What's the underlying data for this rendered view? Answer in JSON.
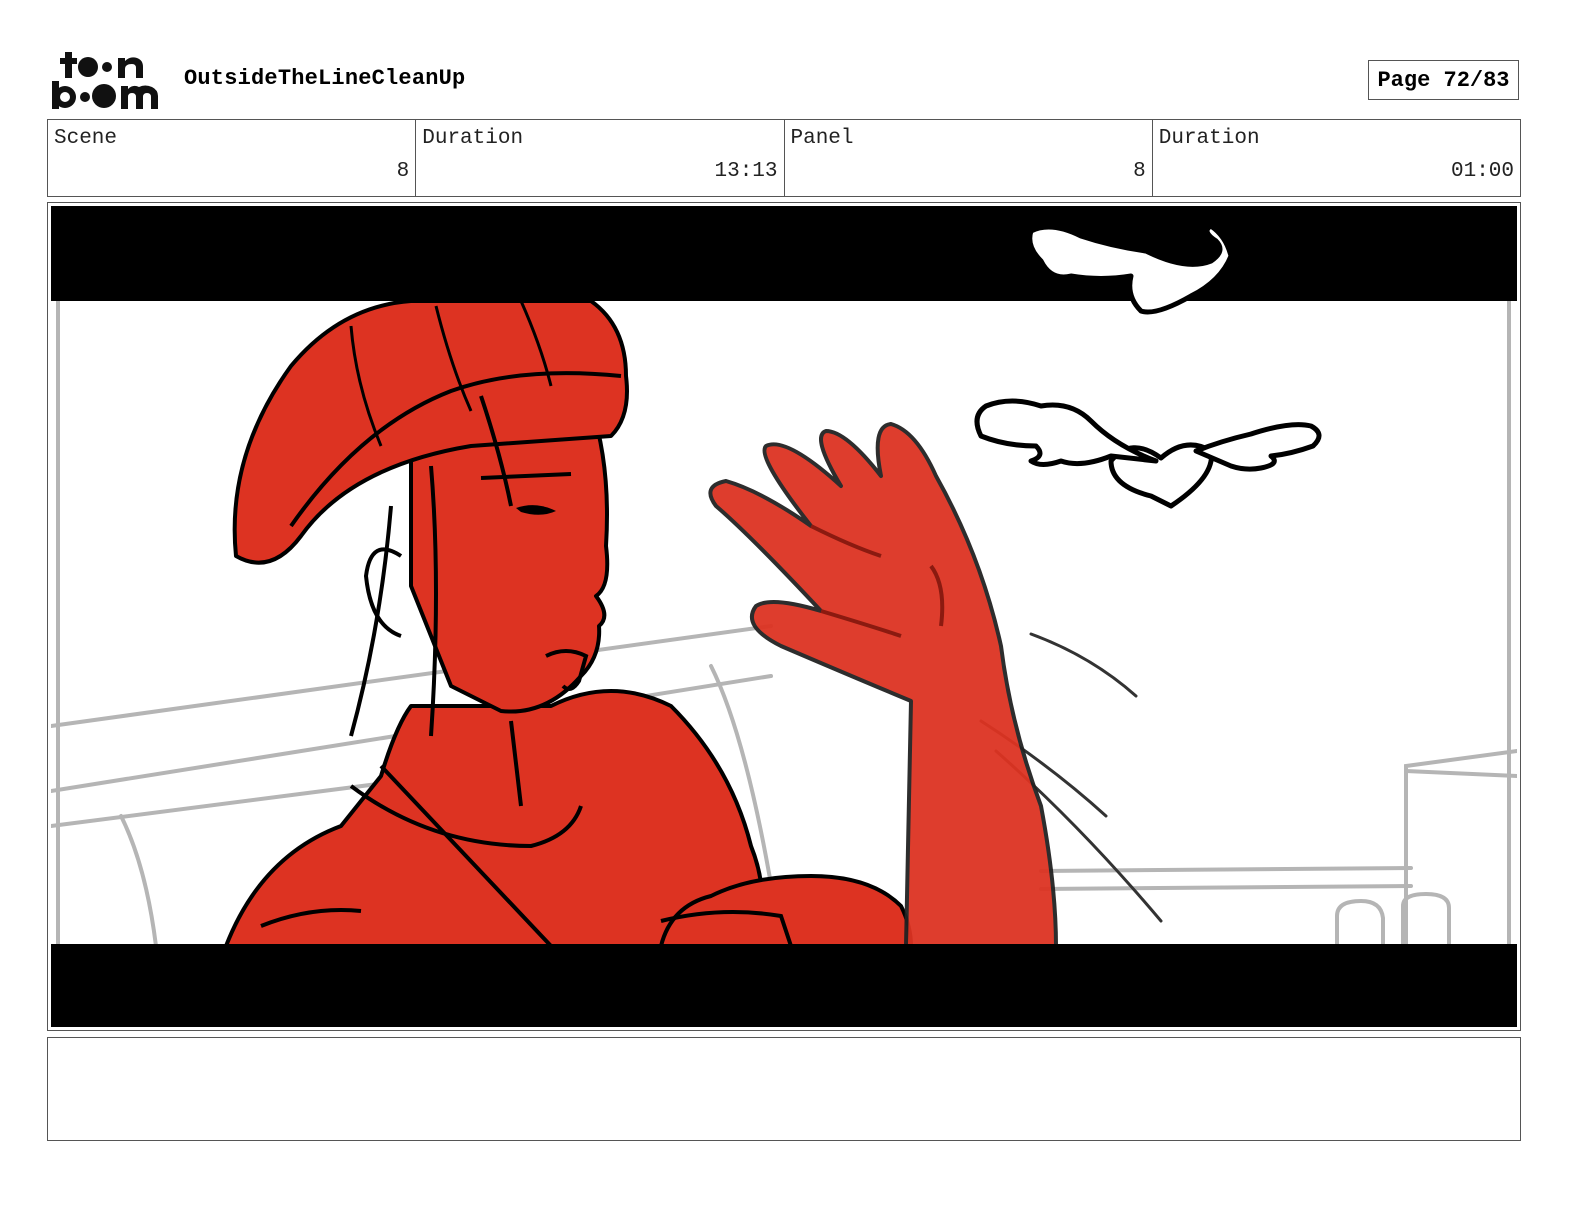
{
  "header": {
    "logo_text": "toon boom",
    "project_title": "OutsideTheLineCleanUp",
    "page_label": "Page 72/83"
  },
  "info": {
    "scene_label": "Scene",
    "scene_value": "8",
    "scene_duration_label": "Duration",
    "scene_duration_value": "13:13",
    "panel_label": "Panel",
    "panel_value": "8",
    "panel_duration_label": "Duration",
    "panel_duration_value": "01:00"
  },
  "panel_image": {
    "description_icon": "storyboard-drawing",
    "colors": {
      "figure": "#dd3322",
      "letterbox": "#000000",
      "background": "#ffffff",
      "sketch": "#b5b5b5"
    }
  },
  "notes": {
    "text": ""
  }
}
